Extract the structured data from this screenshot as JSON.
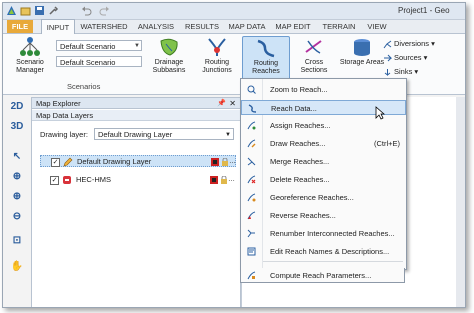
{
  "window": {
    "title": "Project1 - Geo"
  },
  "tabs": [
    "FILE",
    "INPUT",
    "WATERSHED",
    "ANALYSIS",
    "RESULTS",
    "MAP DATA",
    "MAP EDIT",
    "TERRAIN",
    "VIEW"
  ],
  "ribbon": {
    "scenario_manager": "Scenario Manager",
    "scenario_combo_1": "Default Scenario",
    "scenario_combo_2": "Default Scenario",
    "scenarios_group": "Scenarios",
    "buttons": {
      "drainage_subbasins": "Drainage Subbasins",
      "routing_junctions": "Routing Junctions",
      "routing_reaches": "Routing Reaches",
      "cross_sections": "Cross Sections",
      "storage_areas": "Storage Areas"
    },
    "small": {
      "diversions": "Diversions",
      "sources": "Sources",
      "sinks": "Sinks"
    }
  },
  "left_tools": [
    "2D",
    "3D"
  ],
  "map_explorer": {
    "title": "Map Explorer",
    "subtitle": "Map Data Layers",
    "drawing_layer_label": "Drawing layer:",
    "drawing_layer_value": "Default Drawing Layer",
    "layers": [
      {
        "name": "Default Drawing Layer",
        "checked": true
      },
      {
        "name": "HEC-HMS",
        "checked": true
      }
    ]
  },
  "menu": {
    "items": [
      {
        "label": "Zoom to Reach...",
        "shortcut": "",
        "icon": "zoom-reach-icon"
      },
      {
        "label": "Reach Data...",
        "shortcut": "",
        "icon": "reach-data-icon"
      },
      {
        "label": "Assign Reaches...",
        "shortcut": "",
        "icon": "assign-reach-icon"
      },
      {
        "label": "Draw Reaches...",
        "shortcut": "(Ctrl+E)",
        "icon": "draw-reach-icon"
      },
      {
        "label": "Merge Reaches...",
        "shortcut": "",
        "icon": "merge-reach-icon"
      },
      {
        "label": "Delete Reaches...",
        "shortcut": "",
        "icon": "delete-reach-icon"
      },
      {
        "label": "Georeference Reaches...",
        "shortcut": "",
        "icon": "georeference-icon"
      },
      {
        "label": "Reverse Reaches...",
        "shortcut": "",
        "icon": "reverse-reach-icon"
      },
      {
        "label": "Renumber Interconnected Reaches...",
        "shortcut": "",
        "icon": "renumber-icon"
      },
      {
        "label": "Edit Reach Names & Descriptions...",
        "shortcut": "",
        "icon": "edit-names-icon"
      },
      {
        "label": "Compute Reach Parameters...",
        "shortcut": "",
        "icon": "compute-params-icon"
      }
    ]
  },
  "colors": {
    "accent": "#e8a93a",
    "highlight": "#cde3f7",
    "reach": "#2a5fa0"
  }
}
